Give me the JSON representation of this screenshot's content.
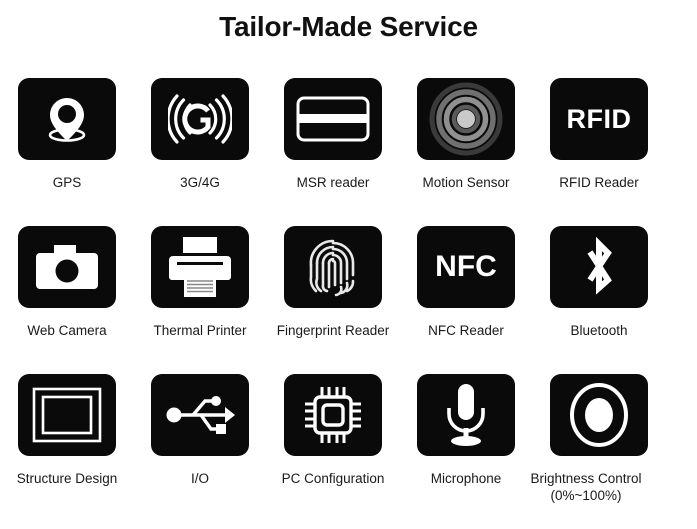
{
  "page": {
    "title": "Tailor-Made Service",
    "background": "#ffffff",
    "tile_color": "#0a0a0a",
    "icon_color": "#ffffff",
    "text_color": "#1a1a1a"
  },
  "rows": [
    {
      "items": [
        {
          "label": "GPS",
          "icon": "gps-pin-icon"
        },
        {
          "label": "3G/4G",
          "icon": "cellular-signal-icon"
        },
        {
          "label": "MSR reader",
          "icon": "magnetic-stripe-card-icon"
        },
        {
          "label": "Motion Sensor",
          "icon": "motion-sensor-rings-icon"
        },
        {
          "label": "RFID Reader",
          "icon": "rfid-text-icon",
          "tile_text": "RFID"
        }
      ]
    },
    {
      "items": [
        {
          "label": "Web Camera",
          "icon": "camera-icon"
        },
        {
          "label": "Thermal Printer",
          "icon": "printer-icon"
        },
        {
          "label": "Fingerprint Reader",
          "icon": "fingerprint-icon"
        },
        {
          "label": "NFC Reader",
          "icon": "nfc-text-icon",
          "tile_text": "NFC"
        },
        {
          "label": "Bluetooth",
          "icon": "bluetooth-icon"
        }
      ]
    },
    {
      "items": [
        {
          "label": "Structure  Design",
          "icon": "nested-rectangles-icon"
        },
        {
          "label": "I/O",
          "icon": "usb-icon"
        },
        {
          "label": "PC  Configuration",
          "icon": "cpu-chip-icon"
        },
        {
          "label": "Microphone",
          "icon": "microphone-icon"
        },
        {
          "label": "Brightness  Control",
          "sublabel": "(0%~100%)",
          "icon": "brightness-ring-icon"
        }
      ]
    }
  ]
}
